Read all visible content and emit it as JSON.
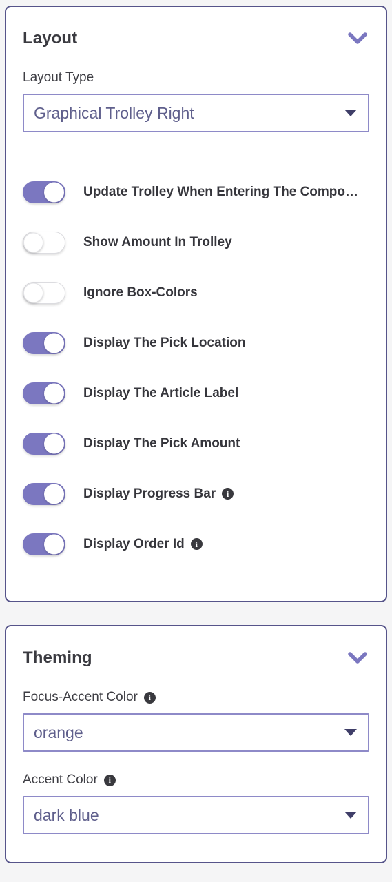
{
  "theme": {
    "page_background": "#f5f5f6",
    "card_border": "#56548a",
    "accent_purple": "#7b77c0",
    "select_border": "#8e8ac8",
    "select_text": "#5f5f8c",
    "heading_color": "#3a3a40"
  },
  "layout_panel": {
    "title": "Layout",
    "collapse_icon": "chevron-down-icon",
    "layout_type": {
      "label": "Layout Type",
      "value": "Graphical Trolley Right",
      "arrow_icon": "caret-down-icon"
    },
    "toggles": [
      {
        "label": "Update Trolley When Entering The Compo…",
        "state": "on",
        "info": false
      },
      {
        "label": "Show Amount In Trolley",
        "state": "off",
        "info": false
      },
      {
        "label": "Ignore Box-Colors",
        "state": "off",
        "info": false
      },
      {
        "label": "Display The Pick Location",
        "state": "on",
        "info": false
      },
      {
        "label": "Display The Article Label",
        "state": "on",
        "info": false
      },
      {
        "label": "Display The Pick Amount",
        "state": "on",
        "info": false
      },
      {
        "label": "Display Progress Bar",
        "state": "on",
        "info": true
      },
      {
        "label": "Display Order Id",
        "state": "on",
        "info": true
      }
    ]
  },
  "theming_panel": {
    "title": "Theming",
    "collapse_icon": "chevron-down-icon",
    "fields": [
      {
        "label": "Focus-Accent Color",
        "info": true,
        "value": "orange",
        "arrow_icon": "caret-down-icon"
      },
      {
        "label": "Accent Color",
        "info": true,
        "value": "dark blue",
        "arrow_icon": "caret-down-icon"
      }
    ]
  },
  "info_glyph": "i"
}
